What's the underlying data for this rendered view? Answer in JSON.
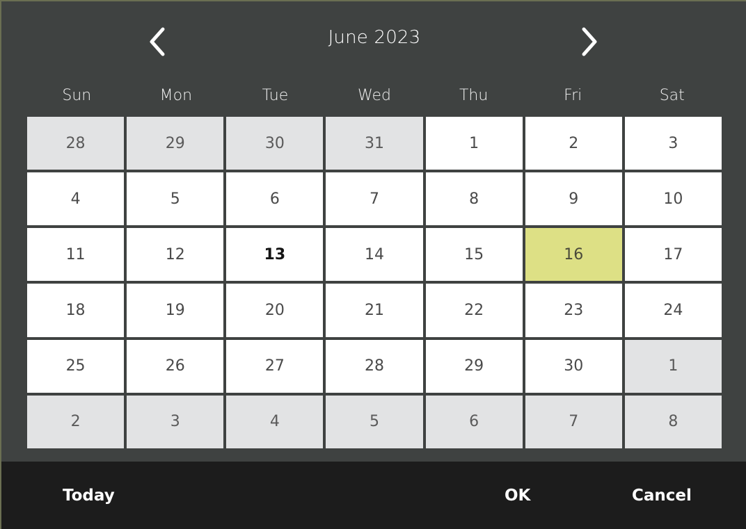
{
  "widget": {
    "name": "date-picker",
    "panel_background": "#3f4241",
    "footer_background": "#1c1c1c",
    "accent_selected": "#dde085",
    "cell_background": "#ffffff",
    "cell_background_adjacent": "#e2e3e4",
    "border_accent": "#6b6f52"
  },
  "header": {
    "title": "June 2023",
    "prev_icon": "chevron-left-icon",
    "next_icon": "chevron-right-icon",
    "prev_label": "Previous month",
    "next_label": "Next month"
  },
  "weekdays": [
    {
      "label": "Sun"
    },
    {
      "label": "Mon"
    },
    {
      "label": "Tue"
    },
    {
      "label": "Wed"
    },
    {
      "label": "Thu"
    },
    {
      "label": "Fri"
    },
    {
      "label": "Sat"
    }
  ],
  "days": [
    {
      "label": "28",
      "adjacent": true,
      "today": false,
      "selected": false
    },
    {
      "label": "29",
      "adjacent": true,
      "today": false,
      "selected": false
    },
    {
      "label": "30",
      "adjacent": true,
      "today": false,
      "selected": false
    },
    {
      "label": "31",
      "adjacent": true,
      "today": false,
      "selected": false
    },
    {
      "label": "1",
      "adjacent": false,
      "today": false,
      "selected": false
    },
    {
      "label": "2",
      "adjacent": false,
      "today": false,
      "selected": false
    },
    {
      "label": "3",
      "adjacent": false,
      "today": false,
      "selected": false
    },
    {
      "label": "4",
      "adjacent": false,
      "today": false,
      "selected": false
    },
    {
      "label": "5",
      "adjacent": false,
      "today": false,
      "selected": false
    },
    {
      "label": "6",
      "adjacent": false,
      "today": false,
      "selected": false
    },
    {
      "label": "7",
      "adjacent": false,
      "today": false,
      "selected": false
    },
    {
      "label": "8",
      "adjacent": false,
      "today": false,
      "selected": false
    },
    {
      "label": "9",
      "adjacent": false,
      "today": false,
      "selected": false
    },
    {
      "label": "10",
      "adjacent": false,
      "today": false,
      "selected": false
    },
    {
      "label": "11",
      "adjacent": false,
      "today": false,
      "selected": false
    },
    {
      "label": "12",
      "adjacent": false,
      "today": false,
      "selected": false
    },
    {
      "label": "13",
      "adjacent": false,
      "today": true,
      "selected": false
    },
    {
      "label": "14",
      "adjacent": false,
      "today": false,
      "selected": false
    },
    {
      "label": "15",
      "adjacent": false,
      "today": false,
      "selected": false
    },
    {
      "label": "16",
      "adjacent": false,
      "today": false,
      "selected": true
    },
    {
      "label": "17",
      "adjacent": false,
      "today": false,
      "selected": false
    },
    {
      "label": "18",
      "adjacent": false,
      "today": false,
      "selected": false
    },
    {
      "label": "19",
      "adjacent": false,
      "today": false,
      "selected": false
    },
    {
      "label": "20",
      "adjacent": false,
      "today": false,
      "selected": false
    },
    {
      "label": "21",
      "adjacent": false,
      "today": false,
      "selected": false
    },
    {
      "label": "22",
      "adjacent": false,
      "today": false,
      "selected": false
    },
    {
      "label": "23",
      "adjacent": false,
      "today": false,
      "selected": false
    },
    {
      "label": "24",
      "adjacent": false,
      "today": false,
      "selected": false
    },
    {
      "label": "25",
      "adjacent": false,
      "today": false,
      "selected": false
    },
    {
      "label": "26",
      "adjacent": false,
      "today": false,
      "selected": false
    },
    {
      "label": "27",
      "adjacent": false,
      "today": false,
      "selected": false
    },
    {
      "label": "28",
      "adjacent": false,
      "today": false,
      "selected": false
    },
    {
      "label": "29",
      "adjacent": false,
      "today": false,
      "selected": false
    },
    {
      "label": "30",
      "adjacent": false,
      "today": false,
      "selected": false
    },
    {
      "label": "1",
      "adjacent": true,
      "today": false,
      "selected": false
    },
    {
      "label": "2",
      "adjacent": true,
      "today": false,
      "selected": false
    },
    {
      "label": "3",
      "adjacent": true,
      "today": false,
      "selected": false
    },
    {
      "label": "4",
      "adjacent": true,
      "today": false,
      "selected": false
    },
    {
      "label": "5",
      "adjacent": true,
      "today": false,
      "selected": false
    },
    {
      "label": "6",
      "adjacent": true,
      "today": false,
      "selected": false
    },
    {
      "label": "7",
      "adjacent": true,
      "today": false,
      "selected": false
    },
    {
      "label": "8",
      "adjacent": true,
      "today": false,
      "selected": false
    }
  ],
  "footer": {
    "today_label": "Today",
    "ok_label": "OK",
    "cancel_label": "Cancel"
  }
}
